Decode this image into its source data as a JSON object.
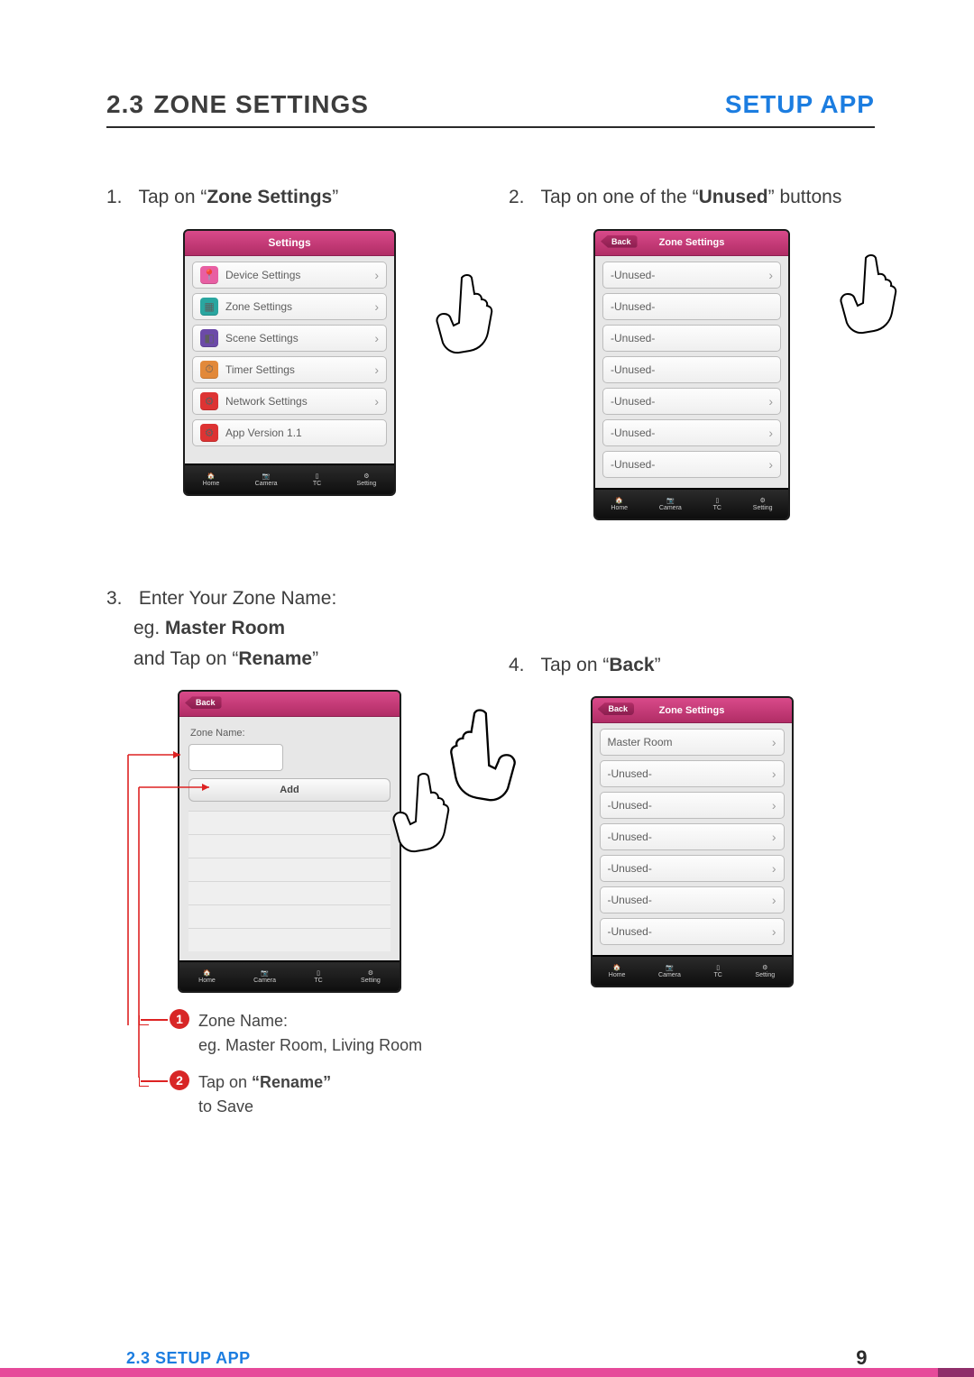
{
  "header": {
    "section_no": "2.3",
    "title": "ZONE SETTINGS",
    "right": "SETUP APP"
  },
  "steps": {
    "s1": {
      "num": "1.",
      "pre": "Tap on “",
      "bold": "Zone Settings",
      "post": "”"
    },
    "s2": {
      "num": "2.",
      "pre": "Tap on one of the “",
      "bold": "Unused",
      "post": "” buttons"
    },
    "s3": {
      "num": "3.",
      "line1": "Enter Your Zone Name:",
      "line2_pre": "eg. ",
      "line2_bold": "Master Room",
      "line3_pre": "and Tap on “",
      "line3_bold": "Rename",
      "line3_post": "”"
    },
    "s4": {
      "num": "4.",
      "pre": "Tap on “",
      "bold": "Back",
      "post": "”"
    }
  },
  "phone1": {
    "title": "Settings",
    "rows": [
      {
        "label": "Device Settings"
      },
      {
        "label": "Zone Settings"
      },
      {
        "label": "Scene Settings"
      },
      {
        "label": "Timer Settings"
      },
      {
        "label": "Network Settings"
      },
      {
        "label": "App Version 1.1"
      }
    ]
  },
  "phone2": {
    "back": "Back",
    "title": "Zone Settings",
    "rows": [
      "-Unused-",
      "-Unused-",
      "-Unused-",
      "-Unused-",
      "-Unused-",
      "-Unused-",
      "-Unused-"
    ]
  },
  "phone3": {
    "back": "Back",
    "zone_label": "Zone Name:",
    "add": "Add"
  },
  "phone4": {
    "back": "Back",
    "title": "Zone Settings",
    "rows": [
      "Master Room",
      "-Unused-",
      "-Unused-",
      "-Unused-",
      "-Unused-",
      "-Unused-",
      "-Unused-"
    ]
  },
  "tabbar": {
    "home": "Home",
    "camera": "Camera",
    "tc": "TC",
    "setting": "Setting"
  },
  "notes": {
    "n1a": "Zone Name:",
    "n1b": "eg. Master Room, Living Room",
    "n2a_pre": "Tap on  ",
    "n2a_bold": "“Rename”",
    "n2b": "to Save"
  },
  "footer": {
    "left_no": "2.3",
    "left_text": "SETUP APP",
    "page": "9"
  }
}
